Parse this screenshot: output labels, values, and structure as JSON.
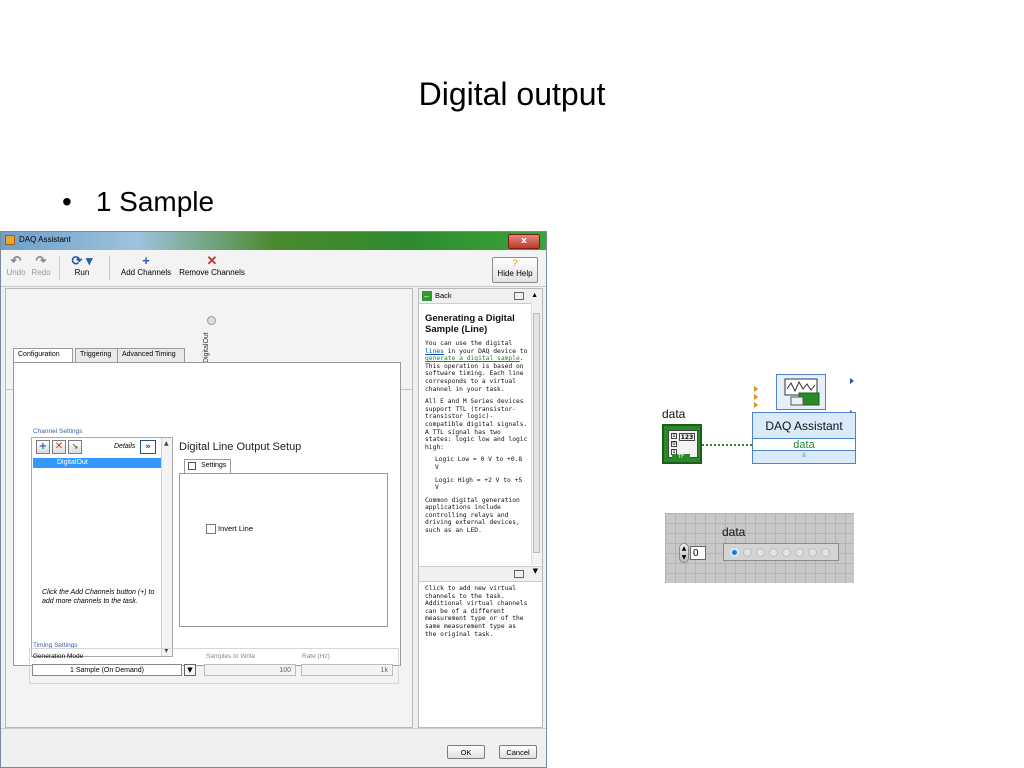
{
  "slide": {
    "title": "Digital output",
    "bullet": "1 Sample"
  },
  "window": {
    "title": "DAQ Assistant",
    "close_label": "x",
    "toolbar": {
      "undo": "Undo",
      "redo": "Redo",
      "run": "Run",
      "add_channels": "Add Channels",
      "remove_channels": "Remove Channels",
      "hide_help": "Hide Help"
    },
    "preview_channel": "DigitalOut",
    "tabs": [
      "Configuration",
      "Triggering",
      "Advanced Timing"
    ],
    "channel_settings": {
      "label": "Channel Settings",
      "details": "Details",
      "details_btn": "»",
      "channels": [
        "DigitalOut"
      ],
      "hint": "Click the Add Channels button (+) to add more channels to the task."
    },
    "setup": {
      "title": "Digital Line Output Setup",
      "tab": "Settings",
      "invert_line": "Invert Line"
    },
    "timing": {
      "label": "Timing Settings",
      "generation_mode_label": "Generation Mode",
      "generation_mode": "1 Sample (On Demand)",
      "samples_label": "Samples to Write",
      "samples": "100",
      "rate_label": "Rate (Hz)",
      "rate": "1k"
    },
    "help": {
      "back": "Back",
      "heading": "Generating a Digital Sample (Line)",
      "p1_pre": "You can use the digital ",
      "p1_link1": "lines",
      "p1_mid": " in your DAQ device to ",
      "p1_link2": "generate a digital sample",
      "p1_post": ". This operation is based on software timing. Each line corresponds to a virtual channel in your task.",
      "p2": "All E and M Series devices support TTL (transistor-transistor logic)-compatible digital signals. A TTL signal has two states: logic low and logic high:",
      "logic_low": "Logic Low = 0 V to +0.8 V",
      "logic_high": "Logic High = +2 V to +5 V",
      "p3": "Common digital generation applications include controlling relays and driving external devices, such as an LED.",
      "context": "Click to add new virtual channels to the task. Additional virtual channels can be of a different measurement type or of the same measurement type as the original task."
    },
    "ok": "OK",
    "cancel": "Cancel"
  },
  "block_diagram": {
    "constant_label": "data",
    "constant_glyph": "123",
    "constant_type": "TF",
    "node_name": "DAQ Assistant",
    "node_terminal": "data",
    "node_expand": "≚"
  },
  "front_panel": {
    "label": "data",
    "index_value": "0",
    "led_count": 8,
    "first_led_on": true,
    "accent": "#1d7bd8"
  }
}
